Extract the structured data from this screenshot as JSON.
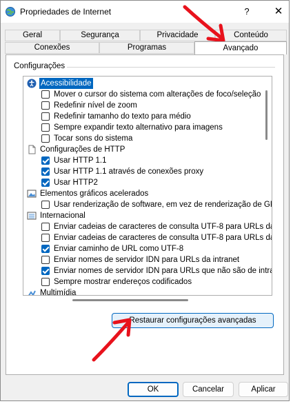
{
  "window": {
    "title": "Propriedades de Internet",
    "help_label": "?",
    "close_label": "✕"
  },
  "tabs_top": [
    {
      "label": "Geral"
    },
    {
      "label": "Segurança"
    },
    {
      "label": "Privacidade"
    },
    {
      "label": "Conteúdo"
    }
  ],
  "tabs_bottom": [
    {
      "label": "Conexões"
    },
    {
      "label": "Programas"
    },
    {
      "label": "Avançado",
      "active": true
    }
  ],
  "settings": {
    "group_label": "Configurações",
    "categories": [
      {
        "label": "Acessibilidade",
        "icon": "accessibility-icon",
        "selected": true,
        "options": [
          {
            "label": "Mover o cursor do sistema com alterações de foco/seleção",
            "checked": false
          },
          {
            "label": "Redefinir nível de zoom",
            "checked": false
          },
          {
            "label": "Redefinir tamanho do texto para médio",
            "checked": false
          },
          {
            "label": "Sempre expandir texto alternativo para imagens",
            "checked": false
          },
          {
            "label": "Tocar sons do sistema",
            "checked": false
          }
        ]
      },
      {
        "label": "Configurações de HTTP",
        "icon": "document-icon",
        "options": [
          {
            "label": "Usar HTTP 1.1",
            "checked": true
          },
          {
            "label": "Usar HTTP 1.1 através de conexões proxy",
            "checked": true
          },
          {
            "label": "Usar HTTP2",
            "checked": true
          }
        ]
      },
      {
        "label": "Elementos gráficos acelerados",
        "icon": "graphics-icon",
        "options": [
          {
            "label": "Usar renderização de software, em vez de renderização de GP",
            "checked": false
          }
        ]
      },
      {
        "label": "Internacional",
        "icon": "list-icon",
        "options": [
          {
            "label": "Enviar cadeias de caracteres de consulta UTF-8 para URLs da I",
            "checked": false
          },
          {
            "label": "Enviar cadeias de caracteres de consulta UTF-8 para URLs da I",
            "checked": false
          },
          {
            "label": "Enviar caminho de URL como UTF-8",
            "checked": true
          },
          {
            "label": "Enviar nomes de servidor IDN para URLs da intranet",
            "checked": false
          },
          {
            "label": "Enviar nomes de servidor IDN para URLs que não são de intran",
            "checked": true
          },
          {
            "label": "Sempre mostrar endereços codificados",
            "checked": false
          }
        ]
      },
      {
        "label": "Multimídia",
        "icon": "multimedia-icon",
        "options": []
      }
    ]
  },
  "buttons": {
    "restore": "Restaurar configurações avançadas",
    "ok": "OK",
    "cancel": "Cancelar",
    "apply": "Aplicar"
  },
  "colors": {
    "accent": "#0067c0",
    "annotation_arrow": "#e8121c"
  }
}
